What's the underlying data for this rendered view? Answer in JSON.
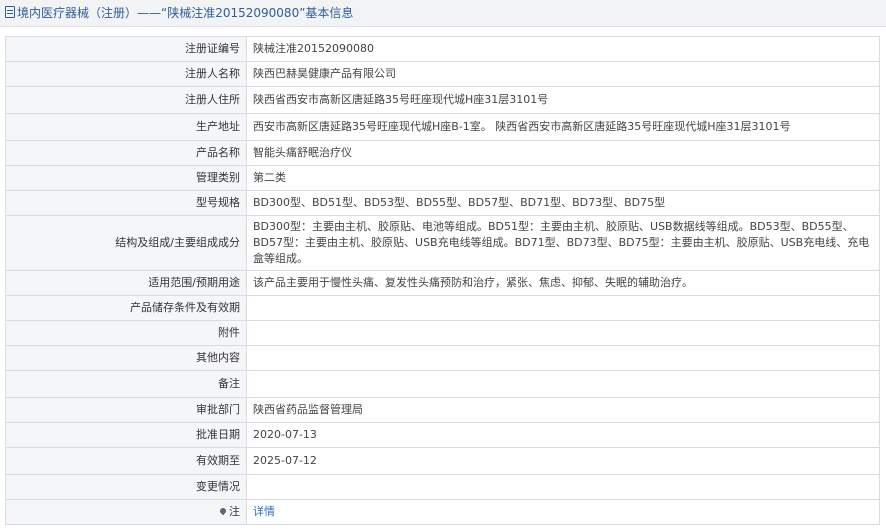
{
  "header": {
    "title": "境内医疗器械（注册）——“陕械注准20152090080”基本信息"
  },
  "rows": [
    {
      "label": "注册证编号",
      "value": "陕械注准20152090080"
    },
    {
      "label": "注册人名称",
      "value": "陕西巴赫昊健康产品有限公司"
    },
    {
      "label": "注册人住所",
      "value": "陕西省西安市高新区唐延路35号旺座现代城H座31层3101号"
    },
    {
      "label": "生产地址",
      "value": "西安市高新区唐延路35号旺座现代城H座B-1室。 陕西省西安市高新区唐延路35号旺座现代城H座31层3101号"
    },
    {
      "label": "产品名称",
      "value": "智能头痛舒眠治疗仪"
    },
    {
      "label": "管理类别",
      "value": "第二类"
    },
    {
      "label": "型号规格",
      "value": "BD300型、BD51型、BD53型、BD55型、BD57型、BD71型、BD73型、BD75型"
    },
    {
      "label": "结构及组成/主要组成成分",
      "value": "BD300型：主要由主机、胶原贴、电池等组成。BD51型：主要由主机、胶原贴、USB数据线等组成。BD53型、BD55型、BD57型：主要由主机、胶原贴、USB充电线等组成。BD71型、BD73型、BD75型：主要由主机、胶原贴、USB充电线、充电盒等组成。"
    },
    {
      "label": "适用范围/预期用途",
      "value": "该产品主要用于慢性头痛、复发性头痛预防和治疗，紧张、焦虑、抑郁、失眠的辅助治疗。"
    },
    {
      "label": "产品储存条件及有效期",
      "value": ""
    },
    {
      "label": "附件",
      "value": ""
    },
    {
      "label": "其他内容",
      "value": ""
    },
    {
      "label": "备注",
      "value": ""
    },
    {
      "label": "审批部门",
      "value": "陕西省药品监督管理局"
    },
    {
      "label": "批准日期",
      "value": "2020-07-13"
    },
    {
      "label": "有效期至",
      "value": "2025-07-12"
    },
    {
      "label": "变更情况",
      "value": ""
    }
  ],
  "note": {
    "label": "注",
    "icon": "pin-icon",
    "link_text": "详情",
    "link_color": "#2d6cb5"
  },
  "colors": {
    "header_bg": "#f2f3f5",
    "header_text": "#2d5f96",
    "label_bg": "#f5f6f8",
    "border": "#d9dde3"
  }
}
